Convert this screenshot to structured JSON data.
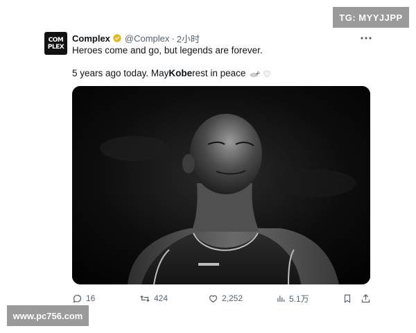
{
  "watermarks": {
    "top_right": "TG: MYYJJPP",
    "bottom_left": "www.pc756.com"
  },
  "tweet": {
    "avatar": {
      "line1": "COM",
      "line2": "PLEX",
      "icon": "complex-logo"
    },
    "author": {
      "display_name": "Complex",
      "handle": "@Complex",
      "separator": "·",
      "timestamp": "2小时",
      "verified_icon": "gold-verified-badge",
      "verified_color": "#e2b719"
    },
    "more_icon": "more-horizontal-icon",
    "text_line1": "Heroes come and go, but legends are forever.",
    "text_line2": {
      "before": "5 years ago today. May ",
      "bold": "Kobe",
      "after": " rest in peace",
      "emojis": [
        "dove-emoji",
        "white-heart-emoji"
      ]
    },
    "media": {
      "kind": "black-and-white photo of a basketball player",
      "icon": "photo"
    },
    "actions": {
      "replies": {
        "icon": "reply-icon",
        "count": "16"
      },
      "retweets": {
        "icon": "retweet-icon",
        "count": "424"
      },
      "likes": {
        "icon": "heart-icon",
        "count": "2,252"
      },
      "views": {
        "icon": "views-icon",
        "count": "5.1万"
      },
      "bookmark": {
        "icon": "bookmark-icon"
      },
      "share": {
        "icon": "share-icon"
      }
    }
  },
  "colors": {
    "text_primary": "#0f1419",
    "text_secondary": "#536471",
    "watermark_bg": "#9a9a9a"
  }
}
